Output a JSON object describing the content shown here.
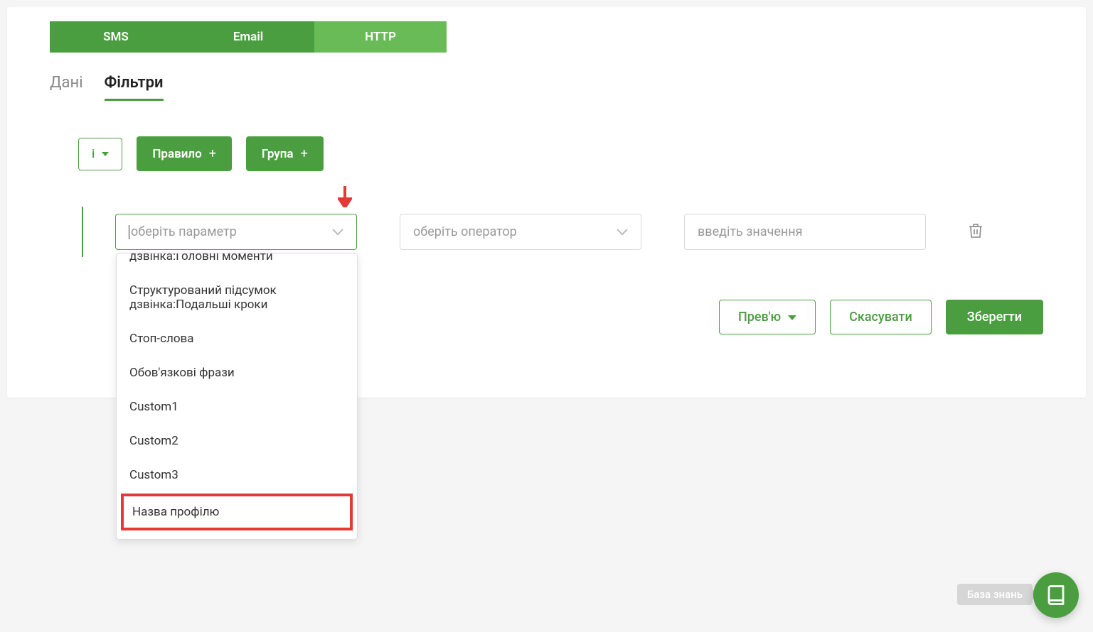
{
  "topTabs": {
    "sms": "SMS",
    "email": "Email",
    "http": "HTTP"
  },
  "subTabs": {
    "data": "Дані",
    "filters": "Фільтри"
  },
  "filterBuilder": {
    "logicLabel": "і",
    "ruleBtn": "Правило",
    "groupBtn": "Група",
    "paramPlaceholder": "оберіть параметр",
    "operatorPlaceholder": "оберіть оператор",
    "valuePlaceholder": "введіть значення"
  },
  "dropdownOptions": {
    "opt0": "дзвінка:Головні моменти",
    "opt1": "Структурований підсумок дзвінка:Подальші кроки",
    "opt2": "Стоп-слова",
    "opt3": "Обов'язкові фрази",
    "opt4": "Custom1",
    "opt5": "Custom2",
    "opt6": "Custom3",
    "opt7": "Назва профілю"
  },
  "actions": {
    "preview": "Прев'ю",
    "cancel": "Скасувати",
    "save": "Зберегти"
  },
  "kbLabel": "База знань"
}
